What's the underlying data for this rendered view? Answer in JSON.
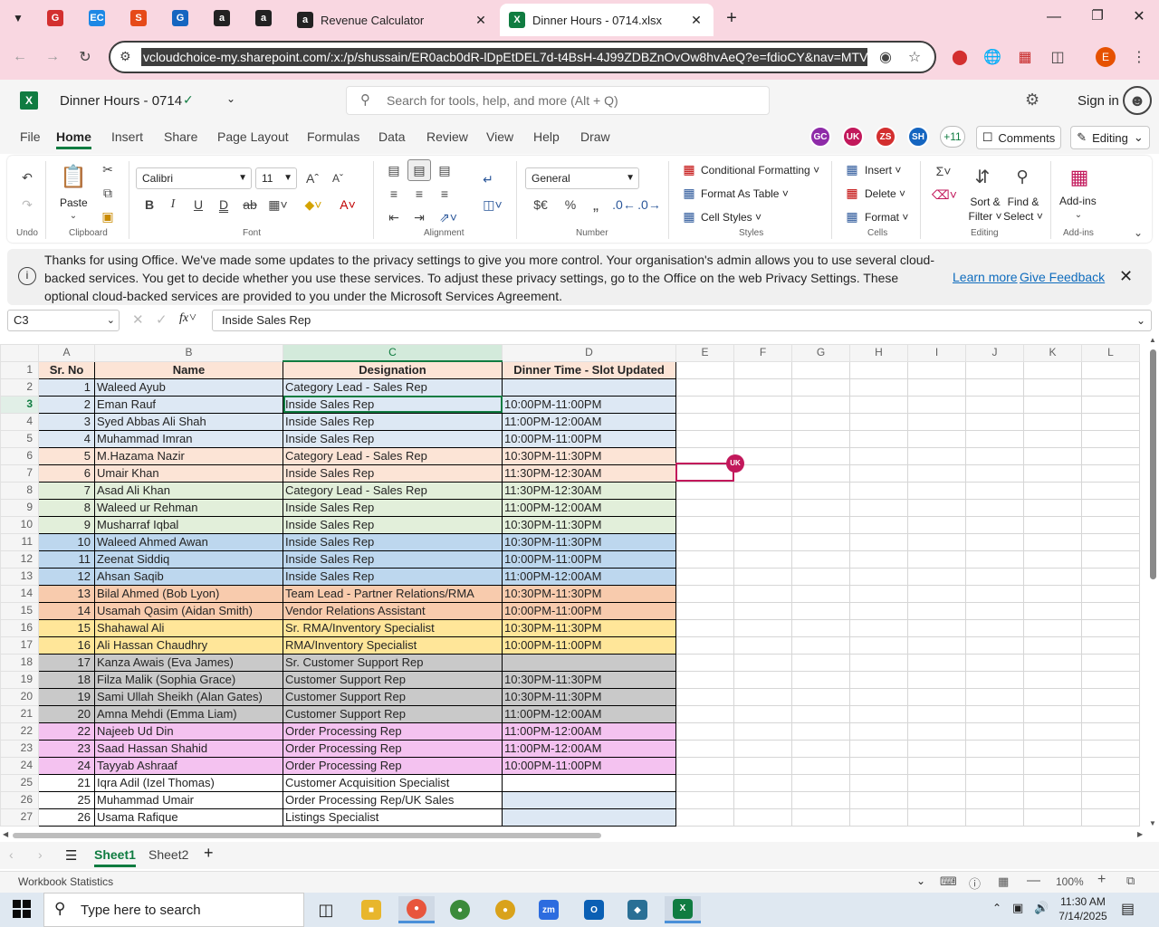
{
  "browser": {
    "pinned_tabs": [
      {
        "icon": "red-app-icon",
        "color": "#d32f2f",
        "glyph": "G"
      },
      {
        "icon": "ec-app-icon",
        "color": "#1e88e5",
        "glyph": "EC"
      },
      {
        "icon": "stacks-icon",
        "color": "#e64a19",
        "glyph": "S"
      },
      {
        "icon": "app-g-icon",
        "color": "#1565c0",
        "glyph": "G"
      },
      {
        "icon": "amazon-icon",
        "color": "#222222",
        "glyph": "a"
      },
      {
        "icon": "amazon-icon",
        "color": "#222222",
        "glyph": "a"
      }
    ],
    "tabs": [
      {
        "title": "Revenue Calculator",
        "active": false
      },
      {
        "title": "Dinner Hours - 0714.xlsx",
        "active": true
      }
    ],
    "url": "vcloudchoice-my.sharepoint.com/:x:/p/shussain/ER0acb0dR-lDpEtDEL7d-t4BsH-4J99ZDBZnOvOw8hvAeQ?e=fdioCY&nav=MTVfez",
    "profile_letter": "E"
  },
  "excel": {
    "doc_title": "Dinner Hours - 0714",
    "search_placeholder": "Search for tools, help, and more (Alt + Q)",
    "sign_in": "Sign in",
    "menu_tabs": [
      "File",
      "Home",
      "Insert",
      "Share",
      "Page Layout",
      "Formulas",
      "Data",
      "Review",
      "View",
      "Help",
      "Draw"
    ],
    "collaborators": [
      {
        "initials": "GC",
        "color": "#8e2ba8"
      },
      {
        "initials": "UK",
        "color": "#c2185b"
      },
      {
        "initials": "ZS",
        "color": "#d32f2f"
      },
      {
        "initials": "SH",
        "color": "#1565c0"
      }
    ],
    "more_collaborators": "+11",
    "comments_label": "Comments",
    "editing_label": "Editing",
    "ribbon": {
      "groups": [
        "Undo",
        "Clipboard",
        "Font",
        "Alignment",
        "Number",
        "Styles",
        "Cells",
        "Editing",
        "Add-ins"
      ],
      "paste": "Paste",
      "font_name": "Calibri",
      "font_size": "11",
      "number_format": "General",
      "currency": "$€",
      "conditional_formatting": "Conditional Formatting",
      "format_as_table": "Format As Table",
      "cell_styles": "Cell Styles",
      "insert": "Insert",
      "delete": "Delete",
      "format": "Format",
      "sort_filter": "Sort & Filter",
      "find_select": "Find & Select",
      "add_ins": "Add-ins"
    },
    "notice": {
      "text": "Thanks for using Office. We've made some updates to the privacy settings to give you more control. Your organisation's admin allows you to use several cloud-backed services. You get to decide whether you use these services. To adjust these privacy settings, go to the Office on the web Privacy Settings. These optional cloud-backed services are provided to you under the Microsoft Services Agreement.",
      "learn_more": "Learn more",
      "give_feedback": "Give Feedback"
    },
    "name_box": "C3",
    "formula": "Inside Sales Rep",
    "columns": [
      "A",
      "B",
      "C",
      "D",
      "E",
      "F",
      "G",
      "H",
      "I",
      "J",
      "K",
      "L"
    ],
    "headers": [
      "Sr. No",
      "Name",
      "Designation",
      "Dinner Time - Slot Updated"
    ],
    "rows": [
      {
        "sr": "1",
        "name": "Waleed Ayub",
        "designation": "Category Lead - Sales Rep",
        "time": "",
        "color": "#dde8f4"
      },
      {
        "sr": "2",
        "name": "Eman Rauf",
        "designation": "Inside Sales Rep",
        "time": "10:00PM-11:00PM",
        "color": "#dde8f4"
      },
      {
        "sr": "3",
        "name": "Syed Abbas Ali Shah",
        "designation": "Inside Sales Rep",
        "time": "11:00PM-12:00AM",
        "color": "#dde8f4"
      },
      {
        "sr": "4",
        "name": "Muhammad Imran",
        "designation": "Inside Sales Rep",
        "time": "10:00PM-11:00PM",
        "color": "#dde8f4"
      },
      {
        "sr": "5",
        "name": "M.Hazama Nazir",
        "designation": "Category Lead - Sales Rep",
        "time": "10:30PM-11:30PM",
        "color": "#fce4d6"
      },
      {
        "sr": "6",
        "name": "Umair Khan",
        "designation": "Inside Sales Rep",
        "time": "11:30PM-12:30AM",
        "color": "#fce4d6"
      },
      {
        "sr": "7",
        "name": "Asad Ali Khan",
        "designation": "Category Lead - Sales Rep",
        "time": "11:30PM-12:30AM",
        "color": "#e2efda"
      },
      {
        "sr": "8",
        "name": "Waleed ur Rehman",
        "designation": "Inside Sales Rep",
        "time": "11:00PM-12:00AM",
        "color": "#e2efda"
      },
      {
        "sr": "9",
        "name": "Musharraf Iqbal",
        "designation": "Inside Sales Rep",
        "time": "10:30PM-11:30PM",
        "color": "#e2efda"
      },
      {
        "sr": "10",
        "name": "Waleed Ahmed Awan",
        "designation": "Inside Sales Rep",
        "time": "10:30PM-11:30PM",
        "color": "#bdd7ee"
      },
      {
        "sr": "11",
        "name": "Zeenat Siddiq",
        "designation": "Inside Sales Rep",
        "time": "10:00PM-11:00PM",
        "color": "#bdd7ee"
      },
      {
        "sr": "12",
        "name": "Ahsan Saqib",
        "designation": "Inside Sales Rep",
        "time": "11:00PM-12:00AM",
        "color": "#bdd7ee"
      },
      {
        "sr": "13",
        "name": "Bilal Ahmed (Bob Lyon)",
        "designation": "Team Lead - Partner Relations/RMA",
        "time": "10:30PM-11:30PM",
        "color": "#f8cbad"
      },
      {
        "sr": "14",
        "name": "Usamah Qasim (Aidan Smith)",
        "designation": "Vendor Relations Assistant",
        "time": "10:00PM-11:00PM",
        "color": "#f8cbad"
      },
      {
        "sr": "15",
        "name": "Shahawal Ali",
        "designation": "Sr. RMA/Inventory Specialist",
        "time": "10:30PM-11:30PM",
        "color": "#ffe699"
      },
      {
        "sr": "16",
        "name": "Ali Hassan Chaudhry",
        "designation": "RMA/Inventory Specialist",
        "time": "10:00PM-11:00PM",
        "color": "#ffe699"
      },
      {
        "sr": "17",
        "name": "Kanza Awais (Eva James)",
        "designation": "Sr. Customer Support Rep",
        "time": "",
        "color": "#c9c9c9"
      },
      {
        "sr": "18",
        "name": "Filza Malik (Sophia Grace)",
        "designation": "Customer Support Rep",
        "time": "10:30PM-11:30PM",
        "color": "#c9c9c9"
      },
      {
        "sr": "19",
        "name": "Sami Ullah Sheikh (Alan Gates)",
        "designation": "Customer Support Rep",
        "time": "10:30PM-11:30PM",
        "color": "#c9c9c9"
      },
      {
        "sr": "20",
        "name": "Amna Mehdi (Emma Liam)",
        "designation": "Customer Support Rep",
        "time": "11:00PM-12:00AM",
        "color": "#c9c9c9"
      },
      {
        "sr": "22",
        "name": "Najeeb Ud Din",
        "designation": "Order Processing Rep",
        "time": "11:00PM-12:00AM",
        "color": "#f4c2f0"
      },
      {
        "sr": "23",
        "name": "Saad Hassan Shahid",
        "designation": "Order Processing Rep",
        "time": "11:00PM-12:00AM",
        "color": "#f4c2f0"
      },
      {
        "sr": "24",
        "name": "Tayyab Ashraaf",
        "designation": "Order Processing Rep",
        "time": "10:00PM-11:00PM",
        "color": "#f4c2f0"
      },
      {
        "sr": "21",
        "name": "Iqra Adil (Izel Thomas)",
        "designation": "Customer Acquisition Specialist",
        "time": "",
        "color": "#ffffff"
      },
      {
        "sr": "25",
        "name": "Muhammad Umair",
        "designation": "Order Processing Rep/UK Sales",
        "time": "",
        "color": "#ffffff",
        "time_color": "#dde8f4"
      },
      {
        "sr": "26",
        "name": "Usama Rafique",
        "designation": "Listings Specialist",
        "time": "",
        "color": "#ffffff",
        "time_color": "#dde8f4"
      }
    ],
    "presence_badge": "UK",
    "sheets": [
      "Sheet1",
      "Sheet2"
    ],
    "status_left": "Workbook Statistics",
    "zoom": "100%"
  },
  "taskbar": {
    "search_placeholder": "Type here to search",
    "time": "11:30 AM",
    "date": "7/14/2025"
  }
}
